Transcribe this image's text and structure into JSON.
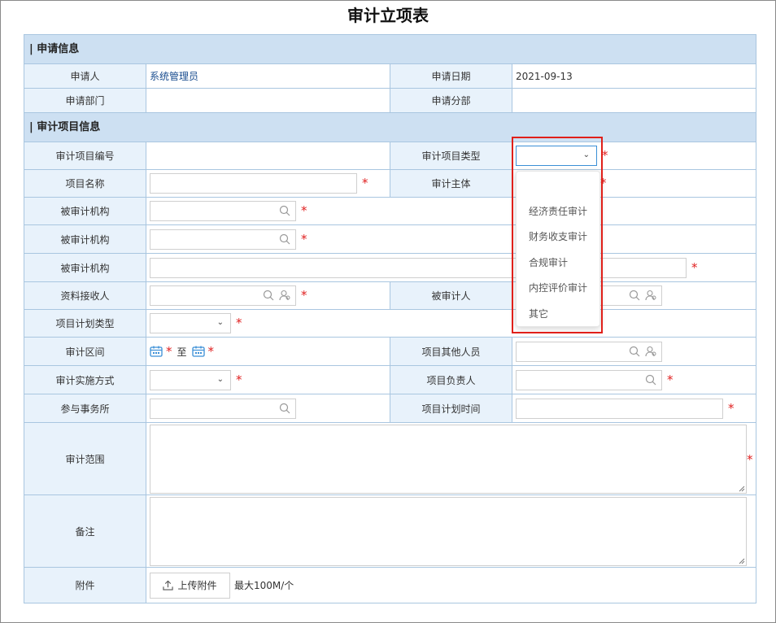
{
  "title": "审计立项表",
  "sections": {
    "apply": "| 申请信息",
    "project": "| 审计项目信息"
  },
  "apply": {
    "applicant_label": "申请人",
    "applicant_value": "系统管理员",
    "date_label": "申请日期",
    "date_value": "2021-09-13",
    "dept_label": "申请部门",
    "branch_label": "申请分部"
  },
  "project": {
    "code_label": "审计项目编号",
    "type_label": "审计项目类型",
    "name_label": "项目名称",
    "subject_label": "审计主体",
    "org1_label": "被审计机构",
    "org2_label": "被审计机构",
    "org3_label": "被审计机构",
    "receiver_label": "资料接收人",
    "auditee_label": "被审计人",
    "plan_type_label": "项目计划类型",
    "interval_label": "审计区间",
    "interval_to": "至",
    "others_label": "项目其他人员",
    "method_label": "审计实施方式",
    "leader_label": "项目负责人",
    "firm_label": "参与事务所",
    "plan_time_label": "项目计划时间",
    "scope_label": "审计范围",
    "remark_label": "备注",
    "attach_label": "附件",
    "upload_label": "上传附件",
    "max_size": "最大100M/个"
  },
  "required_mark": "*",
  "dropdown_options": [
    "经济责任审计",
    "财务收支审计",
    "合规审计",
    "内控评价审计",
    "其它"
  ],
  "colors": {
    "header_bg": "#cde0f2",
    "label_bg": "#e8f2fb",
    "border": "#a9c6e0",
    "required": "#e02020",
    "highlight": "#e0201a"
  }
}
